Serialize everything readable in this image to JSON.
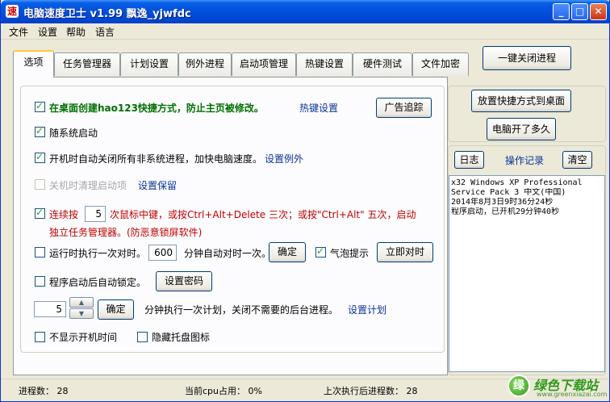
{
  "window": {
    "title": "电脑速度卫士 v1.99 飘逸_yjwfdc",
    "app_icon_glyph": "速",
    "minimize_glyph": "_",
    "maximize_glyph": "□",
    "close_glyph": "✕"
  },
  "menu": {
    "items": [
      "文件",
      "设置",
      "帮助",
      "语言"
    ]
  },
  "tabs": [
    {
      "label": "选项",
      "active": true
    },
    {
      "label": "任务管理器",
      "active": false
    },
    {
      "label": "计划设置",
      "active": false
    },
    {
      "label": "例外进程",
      "active": false
    },
    {
      "label": "启动项管理",
      "active": false
    },
    {
      "label": "热键设置",
      "active": false
    },
    {
      "label": "硬件测试",
      "active": false
    },
    {
      "label": "文件加密",
      "active": false
    }
  ],
  "toolbar": {
    "close_processes_label": "一键关闭进程"
  },
  "options": {
    "desktop_shortcut": {
      "label": "在桌面创建hao123快捷方式，防止主页被修改。",
      "checked": true
    },
    "hotkey_link": "热键设置",
    "ad_tracking_button": "广告追踪",
    "startup": {
      "label": "随系统启动",
      "checked": true
    },
    "auto_close": {
      "label": "开机时自动关闭所有非系统进程，加快电脑速度。",
      "checked": true
    },
    "set_exception_link": "设置例外",
    "shutdown_clean": {
      "label": "关机时清理启动项",
      "checked": false,
      "disabled": true
    },
    "set_keep_link": "设置保留",
    "consecutive": {
      "label": "连续按",
      "value": "5",
      "text_after": "次鼠标中键，或按Ctrl+Alt+Delete 三次；或按\"Ctrl+Alt\" 五次，启动",
      "line2": "独立任务管理器。(防恶意锁屏软件)",
      "checked": true
    },
    "timer": {
      "label": "运行时执行一次对时。",
      "value": "600",
      "text_after": "分钟自动对时一次。",
      "checked": false,
      "confirm_button": "确定"
    },
    "bubble": {
      "label": "气泡提示",
      "checked": true
    },
    "sync_now_button": "立即对时",
    "auto_lock": {
      "label": "程序启动后自动锁定。",
      "checked": false
    },
    "set_password_button": "设置密码",
    "schedule": {
      "value": "5",
      "confirm_button": "确定",
      "text": "分钟执行一次计划，关闭不需要的后台进程。",
      "link": "设置计划"
    },
    "hide_boot_time": {
      "label": "不显示开机时间",
      "checked": false
    },
    "hide_tray": {
      "label": "隐藏托盘图标",
      "checked": false
    }
  },
  "right_panel": {
    "place_shortcut_button": "放置快捷方式到桌面",
    "uptime_button": "电脑开了多久",
    "log_button": "日志",
    "op_record_label": "操作记录",
    "clear_button": "清空",
    "log_lines": [
      "x32 Windows XP Professional",
      "Service Pack 3 中文(中国)",
      " 2014年8月3日9时36分24秒",
      " 程序启动，已开机29分钟40秒"
    ]
  },
  "status": {
    "process_count": "进程数： 28",
    "cpu_usage": "当前cpu占用： 0%",
    "last_exec_count": "上次执行后进程数： 28"
  },
  "watermark": {
    "logo_glyph": "绿",
    "text": "绿色下载站",
    "url": "www.greenxiazai.com"
  }
}
